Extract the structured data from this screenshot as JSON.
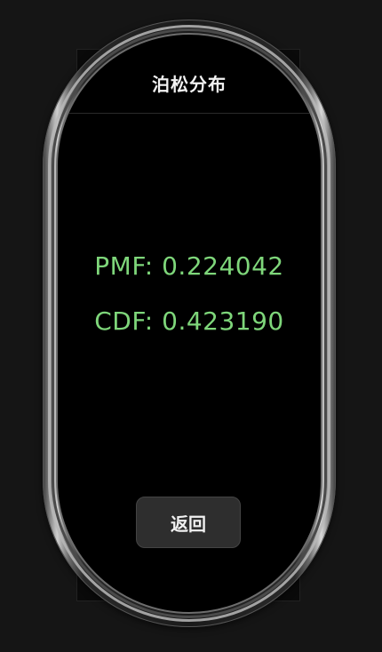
{
  "header": {
    "title": "泊松分布"
  },
  "results": {
    "pmf_label": "PMF:",
    "pmf_value": "0.224042",
    "cdf_label": "CDF:",
    "cdf_value": "0.423190"
  },
  "actions": {
    "back_label": "返回"
  },
  "colors": {
    "background": "#151515",
    "screen": "#000000",
    "result_text": "#7ed67a",
    "title_text": "#f2f2f2",
    "button_bg": "#2e2e2e"
  }
}
